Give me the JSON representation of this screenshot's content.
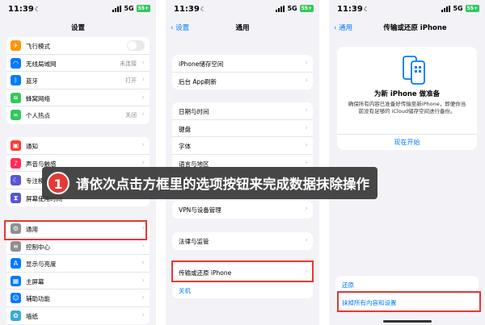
{
  "status": {
    "time": "11:39",
    "network": "5G",
    "battery": "55+"
  },
  "screen1": {
    "title": "设置",
    "groups": [
      [
        {
          "label": "飞行模式",
          "icon": "airplane-icon",
          "color": "#ff9500",
          "glyph": "✈",
          "toggle": true
        },
        {
          "label": "无线局域网",
          "icon": "wifi-icon",
          "color": "#007aff",
          "glyph": "◠",
          "value": "未连接"
        },
        {
          "label": "蓝牙",
          "icon": "bluetooth-icon",
          "color": "#007aff",
          "glyph": "ᛒ",
          "value": "打开"
        },
        {
          "label": "蜂窝网络",
          "icon": "cellular-icon",
          "color": "#34c759",
          "glyph": "≋"
        },
        {
          "label": "个人热点",
          "icon": "hotspot-icon",
          "color": "#34c759",
          "glyph": "∞",
          "value": "关闭"
        }
      ],
      [
        {
          "label": "通知",
          "icon": "notification-icon",
          "color": "#ff3b30",
          "glyph": "▣"
        },
        {
          "label": "声音与触感",
          "icon": "sound-icon",
          "color": "#ff2d55",
          "glyph": "♪"
        },
        {
          "label": "专注模式",
          "icon": "focus-icon",
          "color": "#5856d6",
          "glyph": "☾"
        },
        {
          "label": "屏幕使用时间",
          "icon": "screen-time-icon",
          "color": "#5856d6",
          "glyph": "⧗"
        }
      ],
      [
        {
          "label": "通用",
          "icon": "gear-icon",
          "color": "#8e8e93",
          "glyph": "⚙"
        },
        {
          "label": "控制中心",
          "icon": "control-center-icon",
          "color": "#8e8e93",
          "glyph": "≡"
        },
        {
          "label": "显示与亮度",
          "icon": "display-icon",
          "color": "#007aff",
          "glyph": "A"
        },
        {
          "label": "主屏幕",
          "icon": "home-screen-icon",
          "color": "#007aff",
          "glyph": "▦"
        },
        {
          "label": "辅助功能",
          "icon": "accessibility-icon",
          "color": "#007aff",
          "glyph": "☺"
        },
        {
          "label": "墙纸",
          "icon": "wallpaper-icon",
          "color": "#34aadc",
          "glyph": "✿"
        }
      ]
    ]
  },
  "screen2": {
    "back": "设置",
    "title": "通用",
    "groups": [
      [
        {
          "label": "iPhone储存空间"
        },
        {
          "label": "后台 App刷新"
        }
      ],
      [
        {
          "label": "日期与时间"
        },
        {
          "label": "键盘"
        },
        {
          "label": "字体"
        },
        {
          "label": "语言与地区"
        },
        {
          "label": "词典"
        }
      ],
      [
        {
          "label": "VPN与设备管理"
        }
      ],
      [
        {
          "label": "法律与监管"
        }
      ],
      [
        {
          "label": "传输或还原 iPhone"
        },
        {
          "label": "关机"
        }
      ]
    ]
  },
  "screen3": {
    "back": "通用",
    "title": "传输或还原 iPhone",
    "card_title": "为新 iPhone 做准备",
    "card_desc": "确保所有内容已准备好传输至新iPhone，即便你当前没有足够的 iCloud储存空间进行备份。",
    "card_link": "现在开始",
    "reset": "还原",
    "erase": "抹掉所有内容和设置"
  },
  "callout": {
    "number": "1",
    "text": "请依次点击方框里的选项按钮来完成数据抹除操作"
  },
  "colors": {
    "highlight": "#e53935",
    "ios_blue": "#007aff",
    "background": "#f2f2f7"
  }
}
